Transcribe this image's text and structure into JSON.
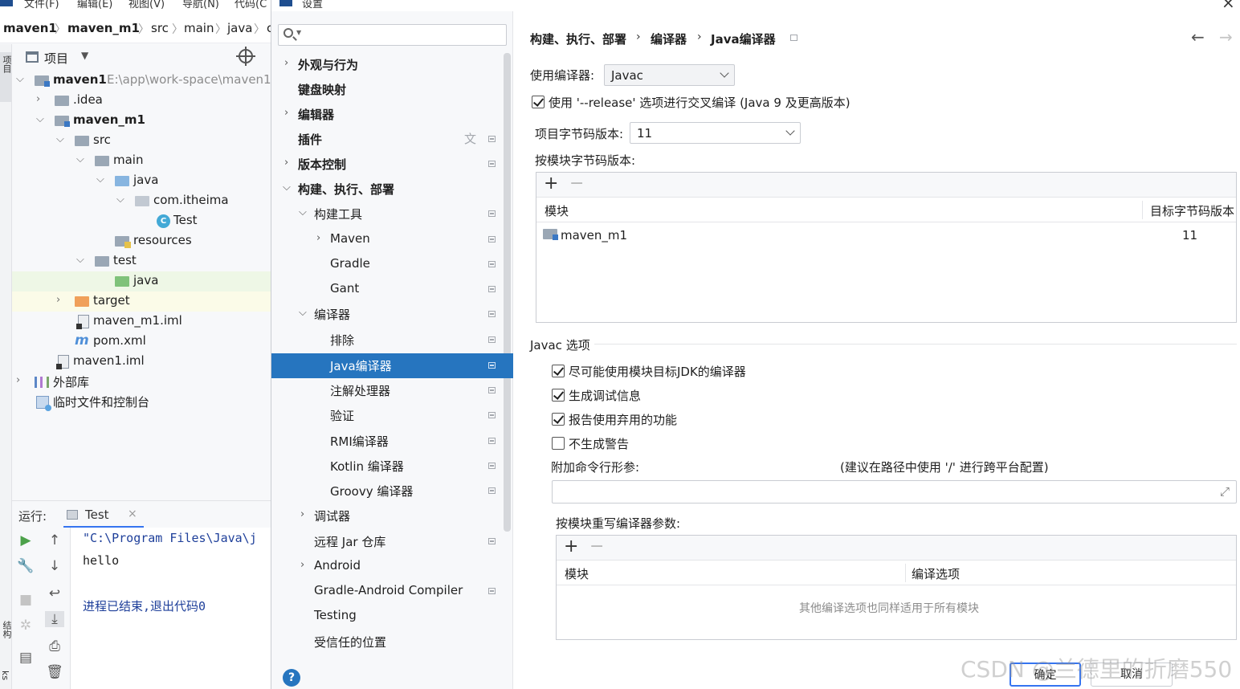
{
  "ide": {
    "menu": [
      "文件(F)",
      "编辑(E)",
      "视图(V)",
      "导航(N)",
      "代码(C"
    ],
    "breadcrumbs": [
      "maven1",
      "maven_m1",
      "src",
      "main",
      "java",
      "c"
    ],
    "left_stripe_label_top": "项目",
    "left_stripe_label_bottom": "结构",
    "left_stripe_label_bottom2": "ks",
    "project_panel": {
      "title": "项目",
      "tree": [
        {
          "label": "maven1",
          "path": "E:\\app\\work-space\\maven1"
        },
        {
          "label": ".idea"
        },
        {
          "label": "maven_m1"
        },
        {
          "label": "src"
        },
        {
          "label": "main"
        },
        {
          "label": "java"
        },
        {
          "label": "com.itheima"
        },
        {
          "label": "Test",
          "icon_letter": "C"
        },
        {
          "label": "resources"
        },
        {
          "label": "test"
        },
        {
          "label": "java"
        },
        {
          "label": "target"
        },
        {
          "label": "maven_m1.iml"
        },
        {
          "label": "pom.xml",
          "icon_letter": "m"
        },
        {
          "label": "maven1.iml"
        },
        {
          "label": "外部库"
        },
        {
          "label": "临时文件和控制台"
        }
      ]
    },
    "run_panel": {
      "label": "运行:",
      "tab": "Test",
      "console": [
        "\"C:\\Program Files\\Java\\j",
        "hello",
        "进程已结束,退出代码0"
      ]
    }
  },
  "dialog": {
    "title": "设置",
    "sidebar": {
      "search_placeholder": "",
      "items": [
        {
          "label": "外观与行为"
        },
        {
          "label": "键盘映射"
        },
        {
          "label": "编辑器"
        },
        {
          "label": "插件"
        },
        {
          "label": "版本控制"
        },
        {
          "label": "构建、执行、部署"
        },
        {
          "label": "构建工具"
        },
        {
          "label": "Maven"
        },
        {
          "label": "Gradle"
        },
        {
          "label": "Gant"
        },
        {
          "label": "编译器"
        },
        {
          "label": "排除"
        },
        {
          "label": "Java编译器"
        },
        {
          "label": "注解处理器"
        },
        {
          "label": "验证"
        },
        {
          "label": "RMI编译器"
        },
        {
          "label": "Kotlin 编译器"
        },
        {
          "label": "Groovy 编译器"
        },
        {
          "label": "调试器"
        },
        {
          "label": "远程 Jar 仓库"
        },
        {
          "label": "Android"
        },
        {
          "label": "Gradle-Android Compiler"
        },
        {
          "label": "Testing"
        },
        {
          "label": "受信任的位置"
        }
      ],
      "help_label": "?"
    },
    "content": {
      "breadcrumb": [
        "构建、执行、部署",
        "编译器",
        "Java编译器"
      ],
      "use_compiler_label": "使用编译器:",
      "use_compiler_value": "Javac",
      "release_option_label": "使用 '--release' 选项进行交叉编译 (Java 9 及更高版本)",
      "project_bytecode_label": "项目字节码版本:",
      "project_bytecode_value": "11",
      "per_module_bytecode_label": "按模块字节码版本:",
      "module_table": {
        "col_module": "模块",
        "col_target": "目标字节码版本",
        "rows": [
          {
            "module": "maven_m1",
            "target": "11"
          }
        ]
      },
      "javac_section": "Javac 选项",
      "options": [
        {
          "label": "尽可能使用模块目标JDK的编译器",
          "checked": true
        },
        {
          "label": "生成调试信息",
          "checked": true
        },
        {
          "label": "报告使用弃用的功能",
          "checked": true
        },
        {
          "label": "不生成警告",
          "checked": false
        }
      ],
      "extra_args_label": "附加命令行形参:",
      "extra_args_hint": "(建议在路径中使用 '/' 进行跨平台配置)",
      "extra_args_value": "",
      "override_label": "按模块重写编译器参数:",
      "override_table": {
        "col_module": "模块",
        "col_options": "编译选项",
        "empty": "其他编译选项也同样适用于所有模块"
      }
    },
    "buttons": {
      "ok": "确定",
      "cancel": "取消"
    }
  },
  "watermark": "CSDN @兰德里的折磨550",
  "colors": {
    "accent": "#2675bf",
    "selection": "#2675bf",
    "primary_border": "#3574f0"
  },
  "icons": [
    "search-icon",
    "chevron-right-icon",
    "chevron-down-icon",
    "page-icon",
    "translate-icon",
    "back-arrow-icon",
    "forward-arrow-icon",
    "plus-icon",
    "minus-icon",
    "expand-icon",
    "help-icon",
    "close-icon"
  ]
}
